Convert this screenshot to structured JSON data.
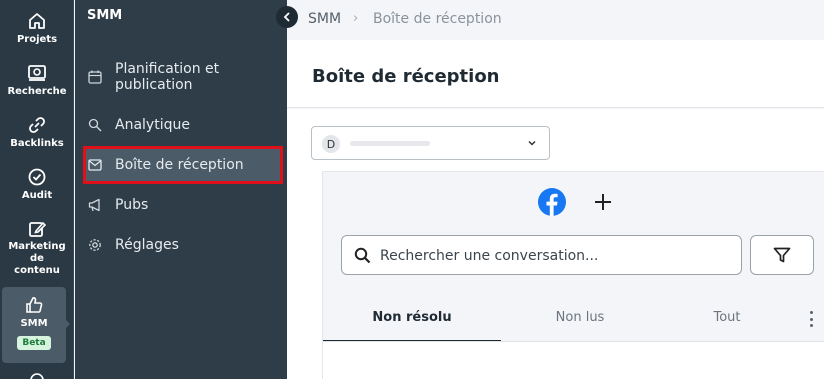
{
  "rail": {
    "items": [
      {
        "label": "Projets",
        "icon": "home-icon"
      },
      {
        "label": "Recherche",
        "icon": "search-icon"
      },
      {
        "label": "Backlinks",
        "icon": "link-icon"
      },
      {
        "label": "Audit",
        "icon": "check-circle-icon"
      },
      {
        "label_lines": [
          "Marketing",
          "de",
          "contenu"
        ],
        "icon": "edit-icon"
      },
      {
        "label": "SMM",
        "icon": "thumbs-up-icon",
        "badge": "Beta",
        "active": true
      }
    ]
  },
  "submenu": {
    "title": "SMM",
    "items": [
      {
        "label_lines": [
          "Planification et",
          "publication"
        ],
        "icon": "calendar-icon"
      },
      {
        "label": "Analytique",
        "icon": "analytics-icon"
      },
      {
        "label": "Boîte de réception",
        "icon": "mail-icon",
        "selected": true
      },
      {
        "label": "Pubs",
        "icon": "megaphone-icon"
      },
      {
        "label": "Réglages",
        "icon": "gear-icon"
      }
    ]
  },
  "breadcrumb": [
    "SMM",
    "Boîte de réception"
  ],
  "page_title": "Boîte de réception",
  "account_select": {
    "avatar_letter": "D"
  },
  "search": {
    "placeholder": "Rechercher une conversation..."
  },
  "tabs": [
    {
      "label": "Non résolu",
      "active": true
    },
    {
      "label": "Non lus"
    },
    {
      "label": "Tout"
    }
  ],
  "colors": {
    "rail_bg": "#2b3944",
    "submenu_bg": "#2f3d48",
    "highlight": "#e0101a",
    "beta_bg": "#d6f3de",
    "facebook": "#1877f2"
  }
}
